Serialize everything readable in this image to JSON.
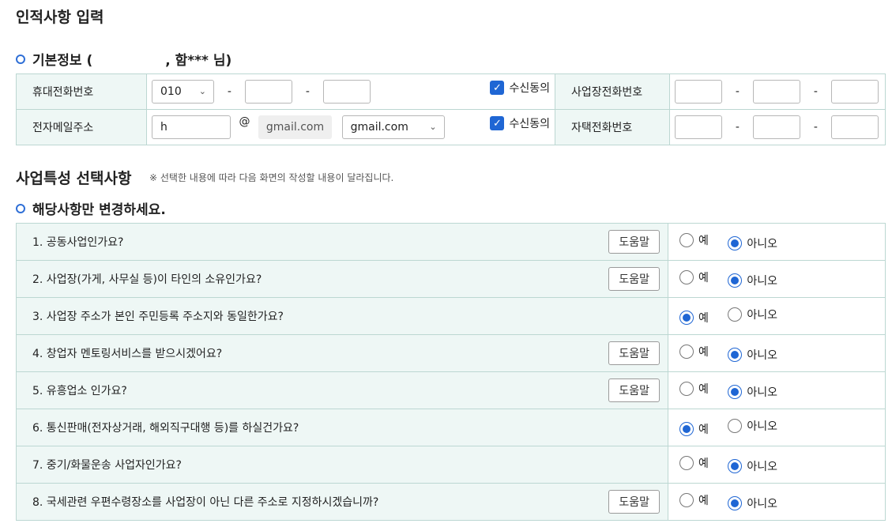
{
  "page_title": "인적사항 입력",
  "basic_info": {
    "heading_prefix": "기본정보 (",
    "heading_suffix": ", 함*** 님)",
    "rows": {
      "mobile_label": "휴대전화번호",
      "mobile_prefix": "010",
      "mobile_mid": "",
      "mobile_last": "",
      "dash": "-",
      "consent_label": "수신동의",
      "business_phone_label": "사업장전화번호",
      "email_label": "전자메일주소",
      "email_local": "h",
      "at": "@",
      "email_domain_fixed": "gmail.com",
      "email_domain_select": "gmail.com",
      "home_phone_label": "자택전화번호"
    },
    "colors": {
      "accent": "#1f66d4",
      "label_bg": "#eef7f5",
      "border": "#bcd7d2"
    }
  },
  "business": {
    "title": "사업특성 선택사항",
    "note": "※ 선택한 내용에 따라 다음 화면의 작성할 내용이 달라집니다.",
    "subheading": "해당사항만 변경하세요.",
    "help_label": "도움말",
    "yes_label": "예",
    "no_label": "아니오",
    "questions": [
      {
        "text": "1. 공동사업인가요?",
        "has_help": true,
        "answer": "no"
      },
      {
        "text": "2. 사업장(가게, 사무실 등)이 타인의 소유인가요?",
        "has_help": true,
        "answer": "no"
      },
      {
        "text": "3. 사업장 주소가 본인 주민등록 주소지와 동일한가요?",
        "has_help": false,
        "answer": "yes"
      },
      {
        "text": "4. 창업자 멘토링서비스를 받으시겠어요?",
        "has_help": true,
        "answer": "no"
      },
      {
        "text": "5. 유흥업소 인가요?",
        "has_help": true,
        "answer": "no"
      },
      {
        "text": "6. 통신판매(전자상거래, 해외직구대행 등)를 하실건가요?",
        "has_help": false,
        "answer": "yes"
      },
      {
        "text": "7. 중기/화물운송 사업자인가요?",
        "has_help": false,
        "answer": "no"
      },
      {
        "text": "8. 국세관련 우편수령장소를 사업장이 아닌 다른 주소로 지정하시겠습니까?",
        "has_help": true,
        "answer": "no"
      }
    ]
  }
}
